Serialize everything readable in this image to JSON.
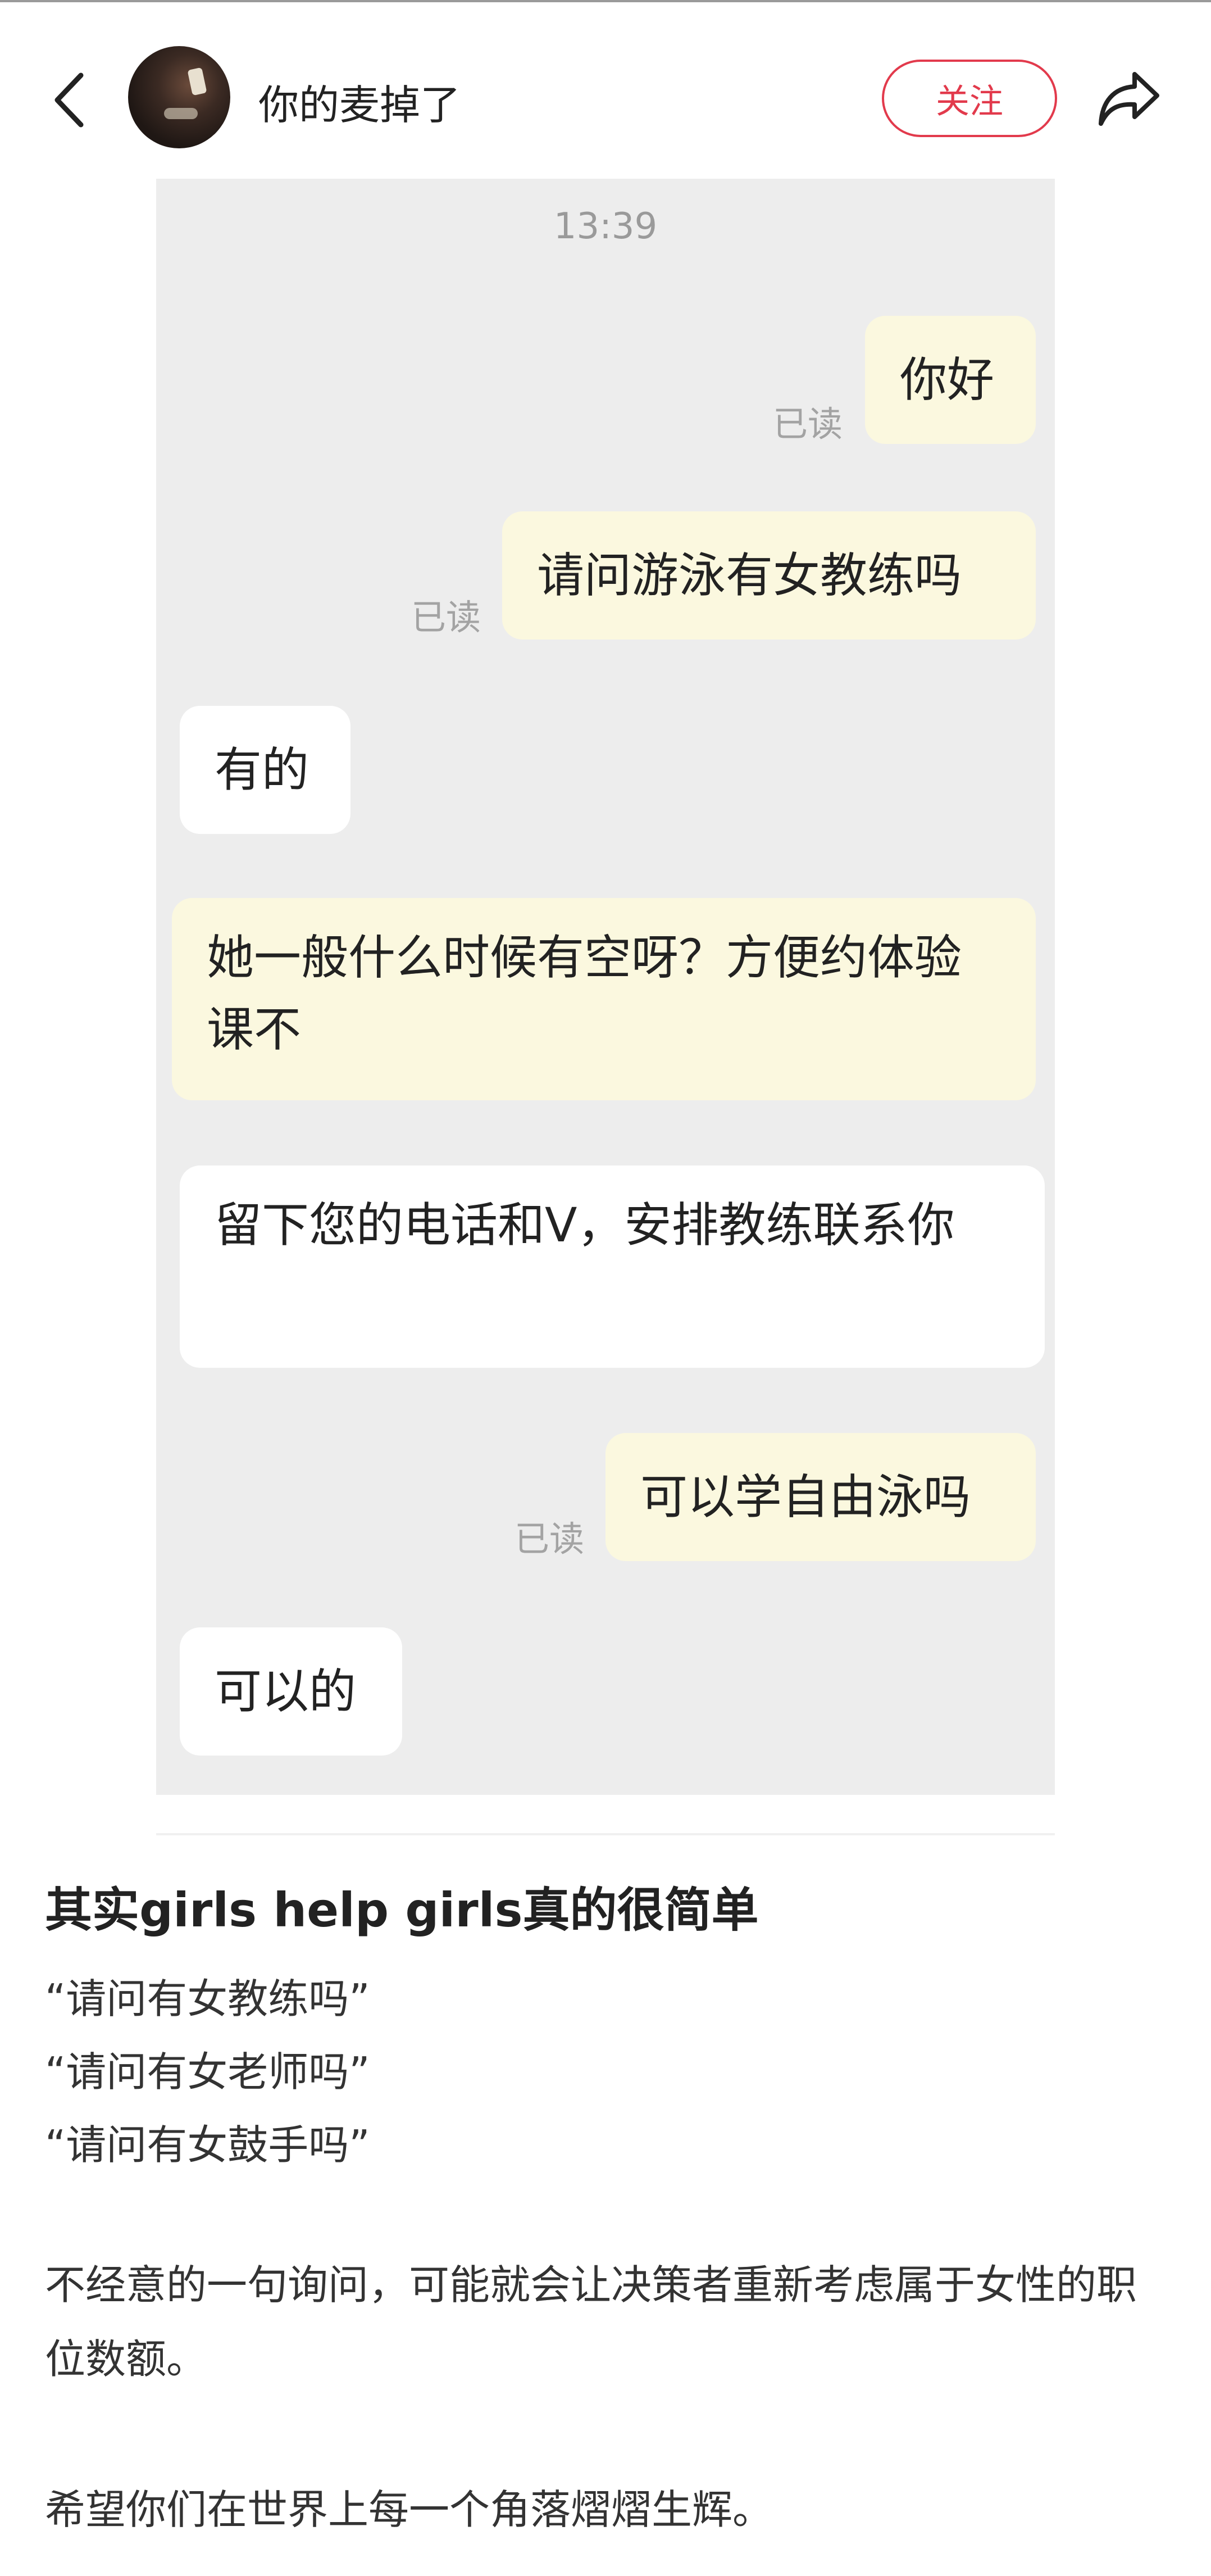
{
  "header": {
    "username": "你的麦掉了",
    "follow_label": "关注",
    "back_icon": "chevron-left-icon",
    "share_icon": "share-arrow-icon"
  },
  "chat": {
    "time": "13:39",
    "messages": [
      {
        "side": "me",
        "text": "你好",
        "read": "已读"
      },
      {
        "side": "me",
        "text": "请问游泳有女教练吗",
        "read": "已读"
      },
      {
        "side": "other",
        "text": "有的"
      },
      {
        "side": "me",
        "text": "她一般什么时候有空呀？方便约体验课不"
      },
      {
        "side": "other",
        "text": "留下您的电话和V，安排教练联系你"
      },
      {
        "side": "me",
        "text": "可以学自由泳吗",
        "read": "已读"
      },
      {
        "side": "other",
        "text": "可以的"
      }
    ]
  },
  "post": {
    "title": "其实girls help girls真的很简单",
    "quotes": [
      "“请问有女教练吗”",
      "“请问有女老师吗”",
      "“请问有女鼓手吗”"
    ],
    "paragraph1": "不经意的一句询问，可能就会让决策者重新考虑属于女性的职位数额。",
    "paragraph2": "希望你们在世界上每一个角落熠熠生辉。"
  },
  "colors": {
    "accent": "#e23a4c",
    "my_bubble": "#fbf8df",
    "other_bubble": "#ffffff",
    "chat_bg": "#ededed"
  }
}
